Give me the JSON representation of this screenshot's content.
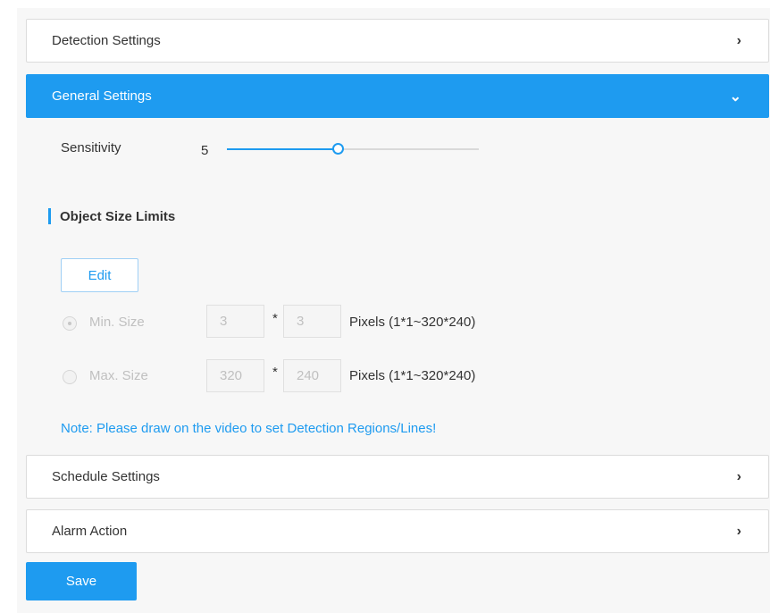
{
  "accordion": {
    "detection": {
      "title": "Detection Settings",
      "chevron": "›"
    },
    "general": {
      "title": "General Settings",
      "chevron": "⌄"
    },
    "schedule": {
      "title": "Schedule Settings",
      "chevron": "›"
    },
    "alarm": {
      "title": "Alarm Action",
      "chevron": "›"
    }
  },
  "general": {
    "sensitivity_label": "Sensitivity",
    "sensitivity_value": "5",
    "sensitivity_fraction": 0.44,
    "section_title": "Object Size Limits",
    "edit_label": "Edit",
    "min": {
      "label": "Min. Size",
      "width": "3",
      "height": "3",
      "checked": true
    },
    "max": {
      "label": "Max. Size",
      "width": "320",
      "height": "240",
      "checked": false
    },
    "times": "*",
    "pixels_hint": "Pixels (1*1~320*240)",
    "note": "Note: Please draw on the video to set Detection Regions/Lines!"
  },
  "save_label": "Save",
  "colors": {
    "accent": "#1e9bf0",
    "panel_bg": "#f7f7f7"
  }
}
